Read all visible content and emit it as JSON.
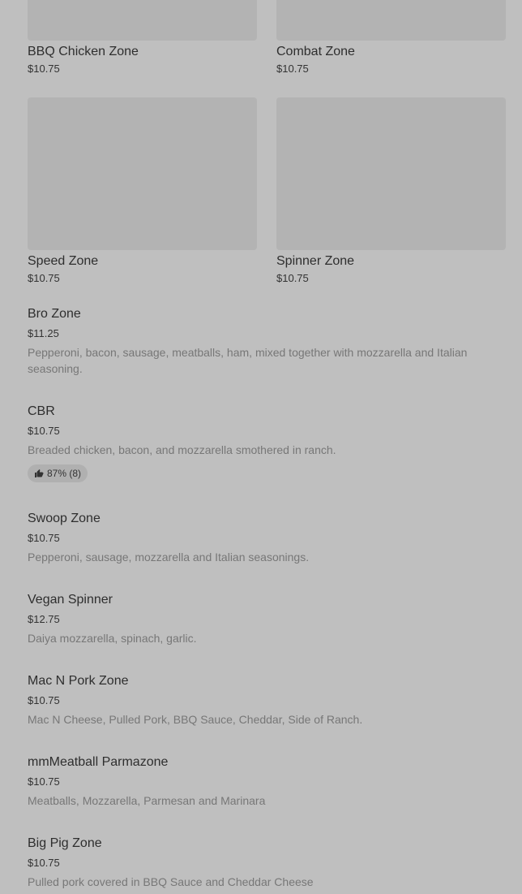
{
  "grid_row_1": [
    {
      "name": "BBQ Chicken Zone",
      "price": "$10.75"
    },
    {
      "name": "Combat Zone",
      "price": "$10.75"
    }
  ],
  "grid_row_2": [
    {
      "name": "Speed Zone",
      "price": "$10.75"
    },
    {
      "name": "Spinner Zone",
      "price": "$10.75"
    }
  ],
  "list": [
    {
      "name": "Bro Zone",
      "price": "$11.25",
      "desc": "Pepperoni, bacon, sausage, meatballs, ham, mixed together with mozzarella and Italian seasoning."
    },
    {
      "name": "CBR",
      "price": "$10.75",
      "desc": "Breaded chicken, bacon, and mozzarella smothered in ranch.",
      "rating": "87% (8)"
    },
    {
      "name": "Swoop Zone",
      "price": "$10.75",
      "desc": "Pepperoni, sausage, mozzarella and Italian seasonings."
    },
    {
      "name": "Vegan Spinner",
      "price": "$12.75",
      "desc": "Daiya mozzarella, spinach, garlic."
    },
    {
      "name": "Mac N Pork Zone",
      "price": "$10.75",
      "desc": "Mac N Cheese, Pulled Pork, BBQ Sauce, Cheddar, Side of Ranch."
    },
    {
      "name": "mmMeatball Parmazone",
      "price": "$10.75",
      "desc": "Meatballs, Mozzarella, Parmesan and Marinara"
    },
    {
      "name": "Big Pig Zone",
      "price": "$10.75",
      "desc": "Pulled pork covered in BBQ Sauce and Cheddar Cheese"
    }
  ]
}
